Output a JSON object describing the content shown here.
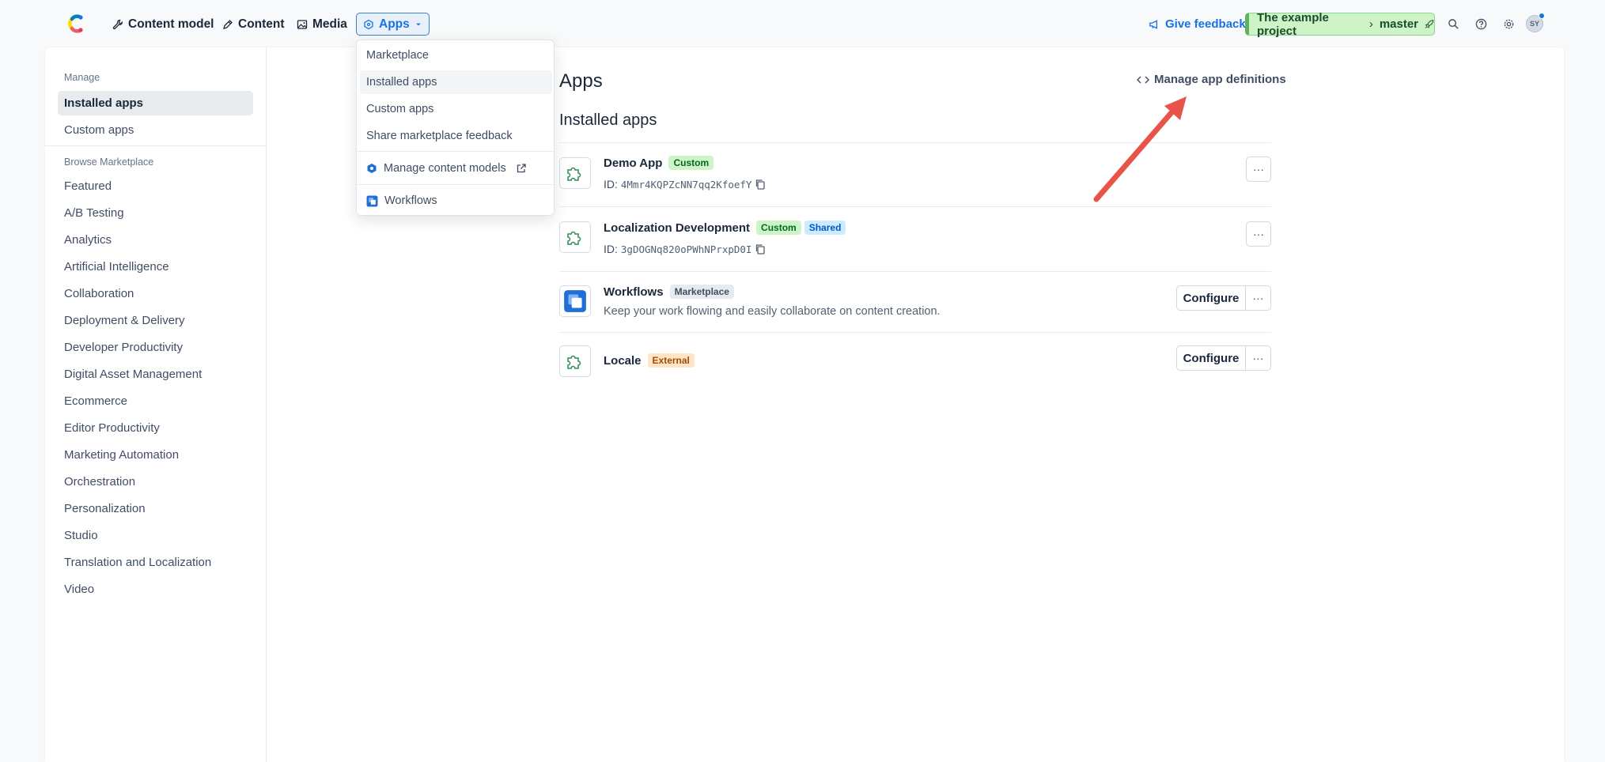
{
  "nav": {
    "items": [
      {
        "label": "Content model",
        "icon": "wrench-icon"
      },
      {
        "label": "Content",
        "icon": "pen-icon"
      },
      {
        "label": "Media",
        "icon": "image-icon"
      },
      {
        "label": "Apps",
        "icon": "apps-icon"
      }
    ],
    "feedback": "Give feedback",
    "project": "The example project",
    "environment": "master",
    "avatar_initials": "SY"
  },
  "dropdown": {
    "items": [
      {
        "label": "Marketplace"
      },
      {
        "label": "Installed apps"
      },
      {
        "label": "Custom apps"
      },
      {
        "label": "Share marketplace feedback"
      },
      {
        "label": "Manage content models"
      },
      {
        "label": "Workflows"
      }
    ]
  },
  "sidebar": {
    "manage_heading": "Manage",
    "manage_items": [
      "Installed apps",
      "Custom apps"
    ],
    "browse_heading": "Browse Marketplace",
    "browse_items": [
      "Featured",
      "A/B Testing",
      "Analytics",
      "Artificial Intelligence",
      "Collaboration",
      "Deployment & Delivery",
      "Developer Productivity",
      "Digital Asset Management",
      "Ecommerce",
      "Editor Productivity",
      "Marketing Automation",
      "Orchestration",
      "Personalization",
      "Studio",
      "Translation and Localization",
      "Video"
    ]
  },
  "main": {
    "title": "Apps",
    "manage_link": "Manage app definitions",
    "section_title": "Installed apps",
    "apps": [
      {
        "name": "Demo App",
        "badges": [
          "Custom"
        ],
        "id_label": "ID:",
        "id": "4Mmr4KQPZcNN7qq2KfoefY",
        "more": "···"
      },
      {
        "name": "Localization Development",
        "badges": [
          "Custom",
          "Shared"
        ],
        "id_label": "ID:",
        "id": "3gDOGNq820oPWhNPrxpD0I",
        "more": "···"
      },
      {
        "name": "Workflows",
        "badges": [
          "Marketplace"
        ],
        "description": "Keep your work flowing and easily collaborate on content creation.",
        "configure": "Configure",
        "more": "···"
      },
      {
        "name": "Locale",
        "badges": [
          "External"
        ],
        "configure": "Configure",
        "more": "···"
      }
    ]
  },
  "colors": {
    "accent": "#1872e5",
    "annotation_arrow": "#e8544a",
    "puzzle_icon": "#2e8b57"
  }
}
